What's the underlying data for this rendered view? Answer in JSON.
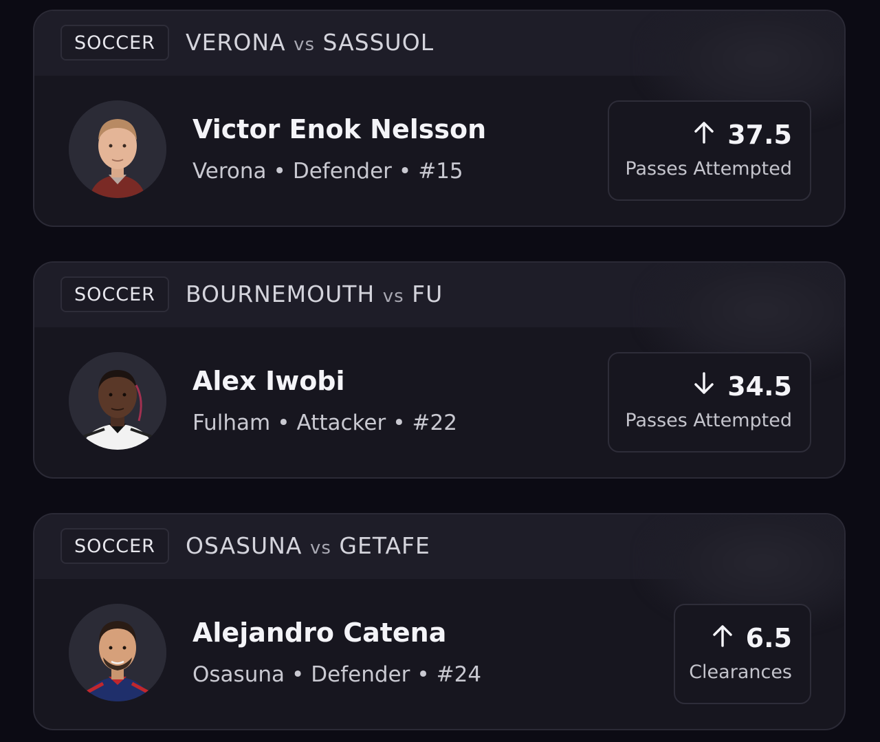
{
  "cards": [
    {
      "sport": "SOCCER",
      "home": "VERONA",
      "vs": "vs",
      "away": "SASSUOL",
      "player_name": "Victor Enok Nelsson",
      "team": "Verona",
      "position": "Defender",
      "number": "#15",
      "direction": "up",
      "line": "37.5",
      "stat": "Passes Attempted"
    },
    {
      "sport": "SOCCER",
      "home": "BOURNEMOUTH",
      "vs": "vs",
      "away": "FU",
      "player_name": "Alex Iwobi",
      "team": "Fulham",
      "position": "Attacker",
      "number": "#22",
      "direction": "down",
      "line": "34.5",
      "stat": "Passes Attempted"
    },
    {
      "sport": "SOCCER",
      "home": "OSASUNA",
      "vs": "vs",
      "away": "GETAFE",
      "player_name": "Alejandro Catena",
      "team": "Osasuna",
      "position": "Defender",
      "number": "#24",
      "direction": "up",
      "line": "6.5",
      "stat": "Clearances"
    }
  ],
  "separator": "•",
  "colors": {
    "background": "#0c0b14",
    "card": "#17161f",
    "header": "#1e1d28"
  }
}
